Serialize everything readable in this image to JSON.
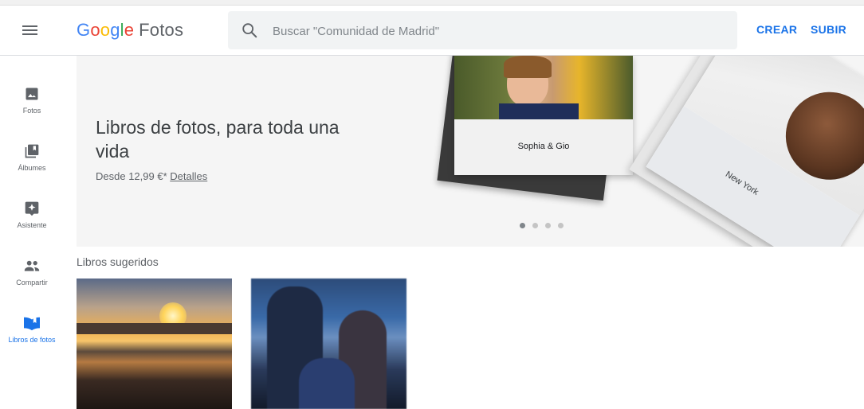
{
  "header": {
    "app_name": "Fotos",
    "logo_letters": [
      "G",
      "o",
      "o",
      "g",
      "l",
      "e"
    ],
    "search_placeholder": "Buscar \"Comunidad de Madrid\"",
    "create_label": "CREAR",
    "upload_label": "SUBIR"
  },
  "sidebar": {
    "items": [
      {
        "label": "Fotos",
        "icon": "photo-icon",
        "active": false
      },
      {
        "label": "Álbumes",
        "icon": "albums-icon",
        "active": false
      },
      {
        "label": "Asistente",
        "icon": "assistant-icon",
        "active": false
      },
      {
        "label": "Compartir",
        "icon": "people-icon",
        "active": false
      },
      {
        "label": "Libros de fotos",
        "icon": "photo-book-icon",
        "active": true
      }
    ]
  },
  "banner": {
    "headline": "Libros de fotos, para toda una vida",
    "price_text": "Desde 12,99 €*",
    "details_link": "Detalles",
    "book1_title": "Sophia & Gio",
    "book2_title": "New York",
    "carousel": {
      "count": 4,
      "active_index": 0
    }
  },
  "suggested": {
    "title": "Libros sugeridos"
  },
  "colors": {
    "accent": "#1a73e8",
    "text_secondary": "#5f6368",
    "banner_bg": "#f5f5f5"
  }
}
